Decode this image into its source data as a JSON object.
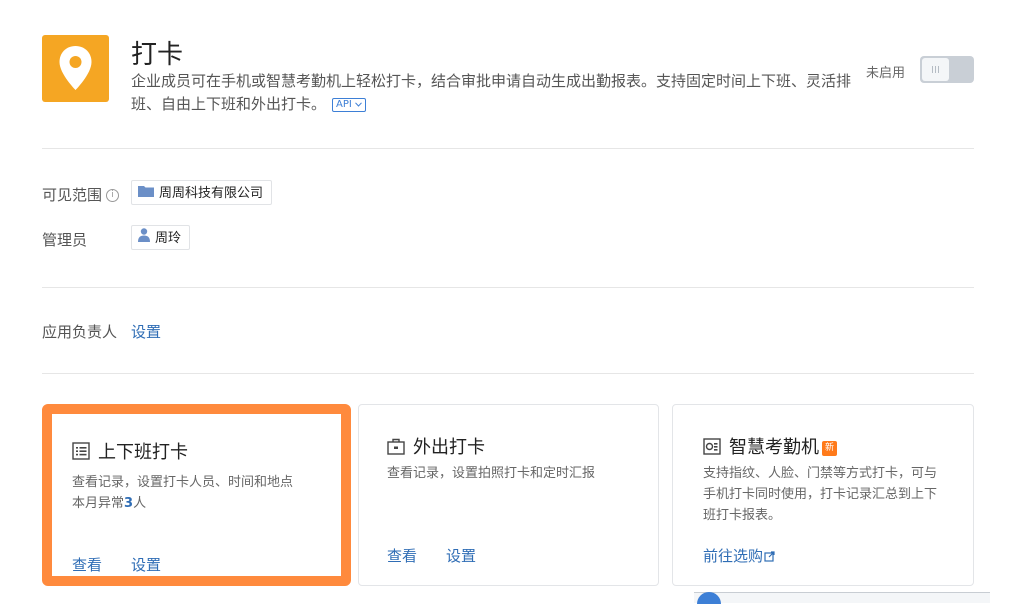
{
  "app": {
    "title": "打卡",
    "description": "企业成员可在手机或智慧考勤机上轻松打卡，结合审批申请自动生成出勤报表。支持固定时间上下班、灵活排班、自由上下班和外出打卡。",
    "api_badge": "API",
    "status_label": "未启用",
    "enabled": false,
    "icon": "location-pin-icon",
    "icon_color": "#f5a623"
  },
  "visibility": {
    "label": "可见范围",
    "value": "周周科技有限公司",
    "icon": "folder-icon"
  },
  "admin": {
    "label": "管理员",
    "value": "周玲",
    "icon": "user-icon"
  },
  "owner": {
    "label": "应用负责人",
    "action": "设置"
  },
  "cards": [
    {
      "title": "上下班打卡",
      "icon": "list-icon",
      "desc": "查看记录，设置打卡人员、时间和地点",
      "abnormal_prefix": "本月异常",
      "abnormal_count": "3",
      "abnormal_suffix": "人",
      "actions": [
        "查看",
        "设置"
      ],
      "selected": true
    },
    {
      "title": "外出打卡",
      "icon": "briefcase-icon",
      "desc": "查看记录，设置拍照打卡和定时汇报",
      "actions": [
        "查看",
        "设置"
      ]
    },
    {
      "title": "智慧考勤机",
      "icon": "attendance-machine-icon",
      "new_badge": "新",
      "desc_lines": [
        "支持指纹、人脸、门禁等方式打卡，可与",
        "手机打卡同时使用，打卡记录汇总到上下",
        "班打卡报表。"
      ],
      "action": "前往选购",
      "action_icon": "external-link-icon"
    }
  ],
  "colors": {
    "link": "#2f6db5",
    "highlight": "#ff8a3d",
    "new_badge": "#ff7a1a"
  }
}
